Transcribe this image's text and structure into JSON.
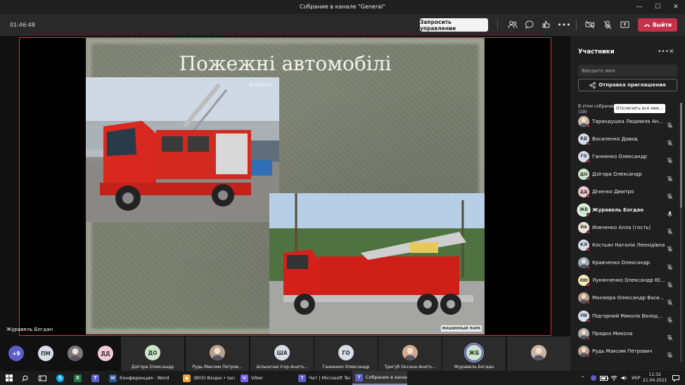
{
  "window": {
    "title": "Собрание в канале \"General\""
  },
  "toolbar": {
    "timer": "01:46:48",
    "request_control": "Запросить управление",
    "leave": "Выйти"
  },
  "slide": {
    "title": "Пожежні автомобілі",
    "watermark": "Autoline",
    "logo_text": "МАШИННЫЙ ПАРК"
  },
  "presenter": "Журавель Богдан",
  "panel": {
    "title": "Участники",
    "search_placeholder": "Введите имя",
    "invite": "Отправка приглашения",
    "section_label": "В этом собрании",
    "section_count": "(19)",
    "mute_all": "Отключить все мик...",
    "participants": [
      {
        "initials": "",
        "name": "Тарандушка Людмила Анато...",
        "color": "#c9b5a2",
        "photo": true,
        "speaking": false
      },
      {
        "initials": "ВД",
        "name": "Василенко Давид",
        "color": "#d7dee8",
        "photo": false,
        "speaking": false
      },
      {
        "initials": "ГО",
        "name": "Ганненко Олександр",
        "color": "#d7dee8",
        "photo": false,
        "speaking": false
      },
      {
        "initials": "ДО",
        "name": "Дзігора Олександр",
        "color": "#cbe6c9",
        "photo": false,
        "speaking": false
      },
      {
        "initials": "ДД",
        "name": "Діченко Дмитро",
        "color": "#f3c9d6",
        "photo": false,
        "speaking": false
      },
      {
        "initials": "ЖБ",
        "name": "Журавель Богдан",
        "color": "#cbe6c9",
        "photo": false,
        "speaking": true
      },
      {
        "initials": "ЙА",
        "name": "Йовченко Алла (гость)",
        "color": "#efe6d8",
        "photo": false,
        "speaking": false
      },
      {
        "initials": "КЛ",
        "name": "Костьян Наталія Леонідівна",
        "color": "#d7dee8",
        "photo": false,
        "speaking": false
      },
      {
        "initials": "",
        "name": "Кравченко Олександр",
        "color": "#9aa7b6",
        "photo": true,
        "speaking": false
      },
      {
        "initials": "ЛЮ",
        "name": "Лукянченко Олександр Юрі...",
        "color": "#f4ecb6",
        "photo": false,
        "speaking": false
      },
      {
        "initials": "",
        "name": "Манзюра Олександр Василь...",
        "color": "#b49b87",
        "photo": true,
        "speaking": false
      },
      {
        "initials": "ПВ",
        "name": "Підгорний Микола Володим...",
        "color": "#d7dee8",
        "photo": false,
        "speaking": false
      },
      {
        "initials": "",
        "name": "Прядко Микола",
        "color": "#a8a8a8",
        "photo": true,
        "speaking": false
      },
      {
        "initials": "",
        "name": "Рудь Максим Петрович",
        "color": "#b9a08d",
        "photo": true,
        "speaking": false
      }
    ]
  },
  "strip": {
    "overflow": "+9",
    "circles": [
      {
        "initials": "ПМ",
        "color": "#d7dee8"
      },
      {
        "initials": "",
        "color": "#7a7a7a"
      },
      {
        "initials": "ДД",
        "color": "#f3c9d6"
      }
    ],
    "tiles": [
      {
        "initials": "ДО",
        "name": "Дзігора Олександр",
        "color": "#cbe6c9",
        "photo": false
      },
      {
        "initials": "",
        "name": "Рудь Максим Петров...",
        "color": "#b9a08d",
        "photo": true
      },
      {
        "initials": "ША",
        "name": "Шльончак Ігор Анато...",
        "color": "#d7dee8",
        "photo": false
      },
      {
        "initials": "ГО",
        "name": "Ганненко Олександр",
        "color": "#d7dee8",
        "photo": false
      },
      {
        "initials": "",
        "name": "Тригуб Оксана Анато...",
        "color": "#d1a98d",
        "photo": true
      },
      {
        "initials": "ЖБ",
        "name": "Журавель Богдан",
        "color": "#cbe6c9",
        "photo": false
      },
      {
        "initials": "",
        "name": "",
        "color": "#c9b5a2",
        "photo": true
      }
    ]
  },
  "taskbar": {
    "apps": [
      {
        "label": "Конференция - Word",
        "icon": "W",
        "color": "#2b579a"
      },
      {
        "label": "(803) Вхідні • taran...",
        "icon": "●",
        "color": "#e8a33a"
      },
      {
        "label": "Viber",
        "icon": "V",
        "color": "#7360f2"
      },
      {
        "label": "Чат | Microsoft Tea...",
        "icon": "T",
        "color": "#5b5fc7"
      },
      {
        "label": "Собрание в канале...",
        "icon": "T",
        "color": "#5b5fc7"
      }
    ],
    "lang": "УКР",
    "time": "11:32",
    "date": "21.04.2021"
  }
}
